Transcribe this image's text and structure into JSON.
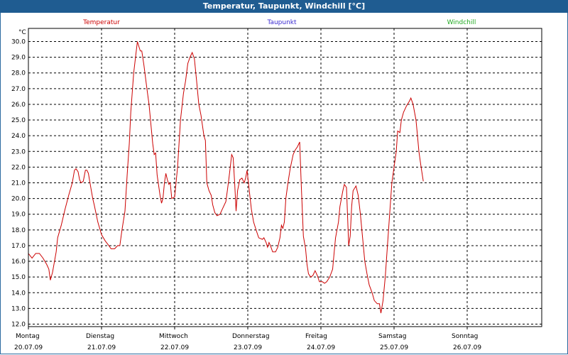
{
  "window": {
    "title": "Temperatur, Taupunkt, Windchill [°C]"
  },
  "chart_data": {
    "type": "line",
    "title": "Temperatur, Taupunkt, Windchill [°C]",
    "ylabel": "°C",
    "ylim": [
      12.0,
      30.0
    ],
    "y_ticks": [
      "30.0",
      "29.0",
      "28.0",
      "27.0",
      "26.0",
      "25.0",
      "24.0",
      "23.0",
      "22.0",
      "21.0",
      "20.0",
      "19.0",
      "18.0",
      "17.0",
      "16.0",
      "15.0",
      "14.0",
      "13.0",
      "12.0"
    ],
    "x_ticks": [
      {
        "day": "Montag",
        "date": "20.07.09"
      },
      {
        "day": "Dienstag",
        "date": "21.07.09"
      },
      {
        "day": "Mittwoch",
        "date": "22.07.09"
      },
      {
        "day": "Donnerstag",
        "date": "23.07.09"
      },
      {
        "day": "Freitag",
        "date": "24.07.09"
      },
      {
        "day": "Samstag",
        "date": "25.07.09"
      },
      {
        "day": "Sonntag",
        "date": "26.07.09"
      }
    ],
    "x_unit": "days since 20.07.09 00:00",
    "grid": true,
    "legend_placement": "top",
    "series": [
      {
        "name": "Temperatur",
        "color": "#cc0000",
        "points": [
          [
            0.0,
            16.5
          ],
          [
            0.05,
            16.2
          ],
          [
            0.1,
            16.5
          ],
          [
            0.15,
            16.5
          ],
          [
            0.2,
            16.2
          ],
          [
            0.25,
            15.8
          ],
          [
            0.28,
            15.5
          ],
          [
            0.3,
            14.8
          ],
          [
            0.33,
            15.3
          ],
          [
            0.38,
            16.6
          ],
          [
            0.4,
            17.5
          ],
          [
            0.45,
            18.3
          ],
          [
            0.5,
            19.3
          ],
          [
            0.55,
            20.2
          ],
          [
            0.6,
            21.0
          ],
          [
            0.63,
            21.8
          ],
          [
            0.65,
            21.9
          ],
          [
            0.68,
            21.7
          ],
          [
            0.7,
            21.2
          ],
          [
            0.72,
            21.0
          ],
          [
            0.75,
            21.1
          ],
          [
            0.78,
            21.8
          ],
          [
            0.8,
            21.8
          ],
          [
            0.82,
            21.6
          ],
          [
            0.85,
            20.8
          ],
          [
            0.88,
            20.0
          ],
          [
            0.9,
            19.6
          ],
          [
            0.95,
            18.5
          ],
          [
            1.0,
            17.7
          ],
          [
            1.05,
            17.3
          ],
          [
            1.1,
            17.0
          ],
          [
            1.13,
            16.8
          ],
          [
            1.18,
            16.8
          ],
          [
            1.22,
            17.0
          ],
          [
            1.25,
            17.0
          ],
          [
            1.28,
            18.0
          ],
          [
            1.32,
            19.2
          ],
          [
            1.35,
            21.5
          ],
          [
            1.38,
            23.5
          ],
          [
            1.4,
            25.5
          ],
          [
            1.44,
            28.0
          ],
          [
            1.47,
            29.2
          ],
          [
            1.49,
            30.0
          ],
          [
            1.51,
            29.7
          ],
          [
            1.53,
            29.4
          ],
          [
            1.55,
            29.4
          ],
          [
            1.58,
            28.5
          ],
          [
            1.62,
            27.0
          ],
          [
            1.65,
            26.0
          ],
          [
            1.68,
            24.5
          ],
          [
            1.7,
            23.5
          ],
          [
            1.72,
            22.8
          ],
          [
            1.74,
            22.9
          ],
          [
            1.76,
            21.5
          ],
          [
            1.8,
            20.2
          ],
          [
            1.82,
            19.7
          ],
          [
            1.84,
            20.0
          ],
          [
            1.86,
            21.0
          ],
          [
            1.88,
            21.6
          ],
          [
            1.9,
            21.2
          ],
          [
            1.92,
            20.9
          ],
          [
            1.94,
            21.0
          ],
          [
            1.96,
            20.0
          ],
          [
            2.0,
            20.1
          ],
          [
            2.04,
            22.0
          ],
          [
            2.08,
            25.0
          ],
          [
            2.12,
            26.7
          ],
          [
            2.15,
            27.5
          ],
          [
            2.18,
            28.6
          ],
          [
            2.21,
            29.0
          ],
          [
            2.24,
            29.3
          ],
          [
            2.27,
            28.9
          ],
          [
            2.3,
            27.5
          ],
          [
            2.33,
            26.0
          ],
          [
            2.36,
            25.3
          ],
          [
            2.4,
            24.0
          ],
          [
            2.42,
            23.7
          ],
          [
            2.44,
            21.0
          ],
          [
            2.47,
            20.5
          ],
          [
            2.5,
            20.2
          ],
          [
            2.52,
            19.6
          ],
          [
            2.55,
            19.1
          ],
          [
            2.58,
            18.9
          ],
          [
            2.62,
            19.0
          ],
          [
            2.65,
            19.3
          ],
          [
            2.7,
            19.8
          ],
          [
            2.72,
            20.5
          ],
          [
            2.74,
            21.2
          ],
          [
            2.76,
            22.0
          ],
          [
            2.78,
            22.8
          ],
          [
            2.8,
            22.6
          ],
          [
            2.82,
            21.0
          ],
          [
            2.84,
            19.2
          ],
          [
            2.86,
            20.5
          ],
          [
            2.89,
            21.2
          ],
          [
            2.92,
            21.3
          ],
          [
            2.95,
            21.0
          ],
          [
            2.97,
            21.3
          ],
          [
            2.99,
            21.8
          ],
          [
            3.02,
            20.5
          ],
          [
            3.05,
            19.3
          ],
          [
            3.08,
            18.5
          ],
          [
            3.12,
            17.9
          ],
          [
            3.15,
            17.5
          ],
          [
            3.2,
            17.4
          ],
          [
            3.22,
            17.5
          ],
          [
            3.25,
            17.2
          ],
          [
            3.27,
            16.9
          ],
          [
            3.29,
            17.2
          ],
          [
            3.31,
            17.0
          ],
          [
            3.34,
            16.6
          ],
          [
            3.38,
            16.6
          ],
          [
            3.41,
            16.9
          ],
          [
            3.44,
            17.5
          ],
          [
            3.46,
            18.3
          ],
          [
            3.48,
            18.1
          ],
          [
            3.5,
            18.5
          ],
          [
            3.52,
            20.0
          ],
          [
            3.55,
            21.0
          ],
          [
            3.58,
            21.9
          ],
          [
            3.62,
            22.8
          ],
          [
            3.65,
            23.1
          ],
          [
            3.68,
            23.3
          ],
          [
            3.71,
            23.6
          ],
          [
            3.73,
            21.0
          ],
          [
            3.76,
            17.6
          ],
          [
            3.79,
            16.8
          ],
          [
            3.81,
            15.8
          ],
          [
            3.83,
            15.2
          ],
          [
            3.86,
            15.0
          ],
          [
            3.89,
            15.1
          ],
          [
            3.92,
            15.4
          ],
          [
            3.95,
            15.1
          ],
          [
            3.98,
            14.7
          ],
          [
            4.02,
            14.7
          ],
          [
            4.05,
            14.6
          ],
          [
            4.08,
            14.7
          ],
          [
            4.12,
            15.0
          ],
          [
            4.16,
            15.5
          ],
          [
            4.18,
            16.5
          ],
          [
            4.2,
            17.5
          ],
          [
            4.24,
            18.5
          ],
          [
            4.26,
            19.5
          ],
          [
            4.3,
            20.5
          ],
          [
            4.32,
            20.9
          ],
          [
            4.35,
            20.7
          ],
          [
            4.38,
            17.0
          ],
          [
            4.4,
            17.6
          ],
          [
            4.42,
            19.5
          ],
          [
            4.44,
            20.5
          ],
          [
            4.48,
            20.8
          ],
          [
            4.51,
            20.2
          ],
          [
            4.54,
            19.0
          ],
          [
            4.57,
            17.5
          ],
          [
            4.6,
            16.0
          ],
          [
            4.63,
            15.2
          ],
          [
            4.66,
            14.5
          ],
          [
            4.7,
            14.0
          ],
          [
            4.73,
            13.5
          ],
          [
            4.77,
            13.3
          ],
          [
            4.8,
            13.3
          ],
          [
            4.82,
            12.7
          ],
          [
            4.85,
            13.5
          ],
          [
            4.88,
            15.0
          ],
          [
            4.91,
            17.0
          ],
          [
            4.94,
            19.0
          ],
          [
            4.97,
            21.0
          ],
          [
            5.0,
            22.0
          ],
          [
            5.03,
            23.0
          ],
          [
            5.05,
            24.3
          ],
          [
            5.08,
            24.2
          ],
          [
            5.1,
            25.0
          ],
          [
            5.13,
            25.5
          ],
          [
            5.17,
            25.9
          ],
          [
            5.21,
            26.2
          ],
          [
            5.23,
            26.4
          ],
          [
            5.26,
            26.0
          ],
          [
            5.3,
            25.0
          ],
          [
            5.32,
            24.0
          ],
          [
            5.34,
            23.0
          ],
          [
            5.37,
            22.0
          ],
          [
            5.4,
            21.1
          ]
        ]
      },
      {
        "name": "Taupunkt",
        "color": "#3a2ad0",
        "points": []
      },
      {
        "name": "Windchill",
        "color": "#22aa22",
        "points": []
      }
    ]
  }
}
